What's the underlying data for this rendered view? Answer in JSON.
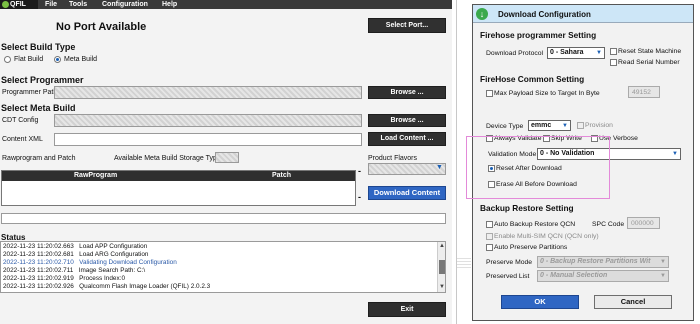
{
  "qfil": {
    "menu": {
      "logo": "QFIL",
      "file": "File",
      "tools": "Tools",
      "configuration": "Configuration",
      "help": "Help"
    },
    "port_status": "No Port Available",
    "select_port_button": "Select Port...",
    "build_type": {
      "heading": "Select Build Type",
      "options": [
        "Flat Build",
        "Meta Build"
      ],
      "selected": "Meta Build"
    },
    "programmer": {
      "heading": "Select Programmer",
      "path_label": "Programmer Path",
      "browse_label": "Browse ..."
    },
    "meta_build": {
      "heading": "Select Meta Build",
      "cdt_label": "CDT Config",
      "cdt_browse": "Browse ...",
      "content_label": "Content XML",
      "load_content": "Load Content ...",
      "rawprogram_label": "Rawprogram and Patch",
      "storage_label": "Available Meta Build Storage Types",
      "flavors_label": "Product Flavors",
      "table_headers": [
        "RawProgram",
        "Patch"
      ],
      "dash": "-",
      "download_content": "Download Content"
    },
    "status": {
      "heading": "Status",
      "log": [
        {
          "time": "2022-11-23 11:20:02.663",
          "msg": "Load APP Configuration",
          "highlight": false
        },
        {
          "time": "2022-11-23 11:20:02.681",
          "msg": "Load ARG Configuration",
          "highlight": false
        },
        {
          "time": "2022-11-23 11:20:02.710",
          "msg": "Validating Download Configuration",
          "highlight": true
        },
        {
          "time": "2022-11-23 11:20:02.711",
          "msg": "Image Search Path: C:\\",
          "highlight": false
        },
        {
          "time": "2022-11-23 11:20:02.919",
          "msg": "Process Index:0",
          "highlight": false
        },
        {
          "time": "2022-11-23 11:20:02.926",
          "msg": "Qualcomm Flash Image Loader (QFIL) 2.0.2.3",
          "highlight": false
        }
      ]
    },
    "exit_button": "Exit"
  },
  "dialog": {
    "title": "Download Configuration",
    "firehose_programmer": {
      "heading": "Firehose programmer Setting",
      "download_protocol_label": "Download Protocol",
      "download_protocol_value": "0 - Sahara",
      "reset_state_machine": "Reset State Machine",
      "read_serial_number": "Read Serial Number"
    },
    "firehose_common": {
      "heading": "FireHose Common Setting",
      "max_payload_label": "Max Payload Size to Target In Byte",
      "max_payload_value": "49152",
      "device_type_label": "Device Type",
      "device_type_value": "emmc",
      "provision_label": "Provision",
      "always_validate": "Always Validate",
      "skip_write": "Skip Write",
      "use_verbose": "Use Verbose",
      "validation_mode_label": "Validation Mode",
      "validation_mode_value": "0 - No Validation",
      "reset_after_download": "Reset After Download",
      "reset_after_download_checked": true,
      "erase_all_before_download": "Erase All Before Download"
    },
    "backup_restore": {
      "heading": "Backup Restore Setting",
      "auto_backup_label": "Auto Backup Restore QCN",
      "spc_code_label": "SPC Code",
      "spc_code_value": "000000",
      "enable_multi_sim": "Enable Multi-SIM QCN (QCN only)",
      "auto_preserve": "Auto Preserve Partitions",
      "preserve_mode_label": "Preserve Mode",
      "preserve_mode_value": "0 - Backup Restore Partitions Wit",
      "preserved_list_label": "Preserved List",
      "preserved_list_value": "0 - Manual Selection"
    },
    "ok_button": "OK",
    "cancel_button": "Cancel"
  },
  "colors": {
    "menubar": "#3a3a3a",
    "dark_button": "#303030",
    "download_button": "#2f66c3",
    "dialog_titlebar": "#cde6f7",
    "highlight_box": "#e38ad9",
    "log_highlight": "#2b5aa8"
  }
}
